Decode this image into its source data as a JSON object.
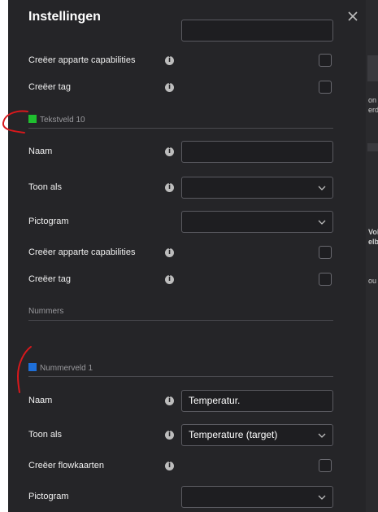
{
  "dialog": {
    "title": "Instellingen"
  },
  "sections": {
    "tekstveld": {
      "label": "Tekstveld 10",
      "color": "#1fbf2f"
    },
    "nummers": {
      "label": "Nummers"
    },
    "nummerveld": {
      "label": "Nummerveld 1",
      "color": "#1e6fd9"
    }
  },
  "rows": {
    "capabilities_1": "Creëer apparte capabilities",
    "tag_1": "Creëer tag",
    "naam_1": "Naam",
    "toon_1": "Toon als",
    "picto_1": "Pictogram",
    "capabilities_2": "Creëer apparte capabilities",
    "tag_2": "Creëer tag",
    "naam_2": "Naam",
    "naam_2_value": "Temperatur.",
    "toon_2": "Toon als",
    "toon_2_value": "Temperature (target)",
    "flow_2": "Creëer flowkaarten",
    "picto_2": "Pictogram"
  },
  "background_fragments": {
    "f1": "on",
    "f2": "erd",
    "f3": "Vol",
    "f4": "elb",
    "f5": "ou"
  },
  "icons": {
    "close": "close-icon",
    "info": "info-icon",
    "chevron": "chevron-down-icon"
  },
  "annotation_color": "#d9181c"
}
